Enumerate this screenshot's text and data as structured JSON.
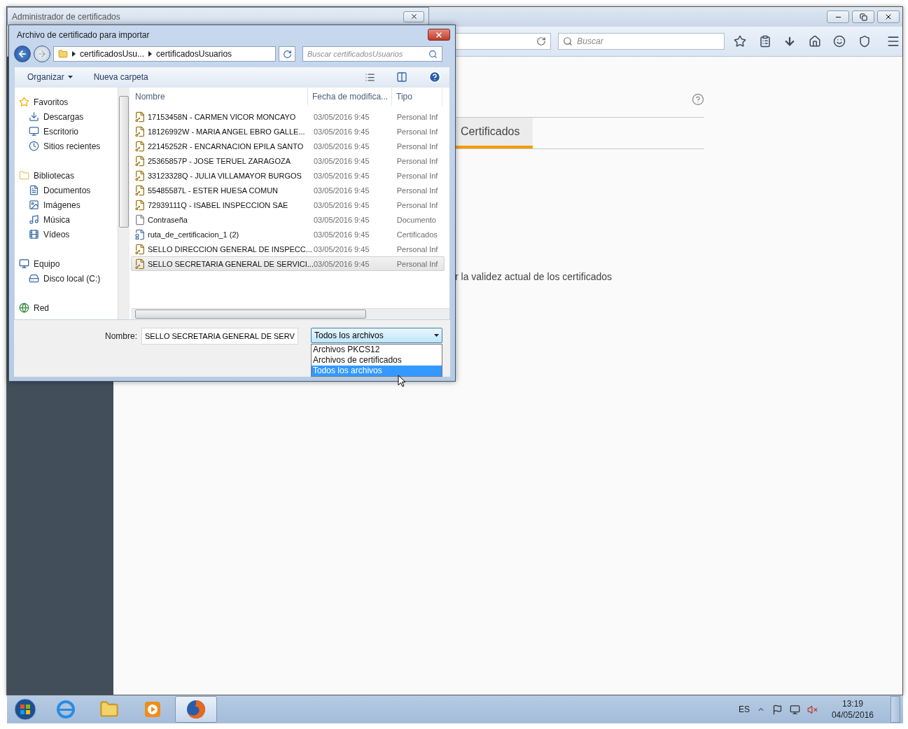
{
  "browser": {
    "search_placeholder": "Buscar",
    "tab": {
      "label": "Certificados",
      "selected": true
    },
    "text": "r la validez actual de los certificados"
  },
  "admin_window": {
    "title": "Administrador de certificados"
  },
  "file_dialog": {
    "title": "Archivo de certificado para importar",
    "breadcrumb": [
      "certificadosUsu...",
      "certificadosUsuarios"
    ],
    "search_placeholder": "Buscar certificadosUsuarios",
    "toolbar": [
      "Organizar",
      "Nueva carpeta"
    ],
    "nav": [
      {
        "label": "Favoritos",
        "children": [
          {
            "label": "Descargas"
          },
          {
            "label": "Escritorio"
          },
          {
            "label": "Sitios recientes"
          }
        ]
      },
      {
        "label": "Bibliotecas",
        "children": [
          {
            "label": "Documentos"
          },
          {
            "label": "Imágenes"
          },
          {
            "label": "Música"
          },
          {
            "label": "Vídeos"
          }
        ]
      },
      {
        "label": "Equipo",
        "children": [
          {
            "label": "Disco local (C:)"
          }
        ]
      },
      {
        "label": "Red"
      }
    ],
    "columns": [
      "Nombre",
      "Fecha de modifica...",
      "Tipo"
    ],
    "files": [
      {
        "name": "17153458N - CARMEN VICOR MONCAYO",
        "date": "03/05/2016 9:45",
        "type": "Personal Inf",
        "kind": "pfx",
        "selected": false
      },
      {
        "name": "18126992W - MARIA ANGEL EBRO GALLE...",
        "date": "03/05/2016 9:45",
        "type": "Personal Inf",
        "kind": "pfx",
        "selected": false
      },
      {
        "name": "22145252R - ENCARNACION EPILA SANTO",
        "date": "03/05/2016 9:45",
        "type": "Personal Inf",
        "kind": "pfx",
        "selected": false
      },
      {
        "name": "25365857P - JOSE TERUEL ZARAGOZA",
        "date": "03/05/2016 9:45",
        "type": "Personal Inf",
        "kind": "pfx",
        "selected": false
      },
      {
        "name": "33123328Q - JULIA VILLAMAYOR BURGOS",
        "date": "03/05/2016 9:45",
        "type": "Personal Inf",
        "kind": "pfx",
        "selected": false
      },
      {
        "name": "55485587L - ESTER HUESA COMUN",
        "date": "03/05/2016 9:45",
        "type": "Personal Inf",
        "kind": "pfx",
        "selected": false
      },
      {
        "name": "72939111Q - ISABEL INSPECCION SAE",
        "date": "03/05/2016 9:45",
        "type": "Personal Inf",
        "kind": "pfx",
        "selected": false
      },
      {
        "name": "Contraseña",
        "date": "03/05/2016 9:45",
        "type": "Documento",
        "kind": "doc",
        "selected": false
      },
      {
        "name": "ruta_de_certificacion_1 (2)",
        "date": "03/05/2016 9:45",
        "type": "Certificados",
        "kind": "cert",
        "selected": false
      },
      {
        "name": "SELLO DIRECCION GENERAL DE INSPECC...",
        "date": "03/05/2016 9:45",
        "type": "Personal Inf",
        "kind": "pfx",
        "selected": false
      },
      {
        "name": "SELLO SECRETARIA GENERAL DE SERVICI...",
        "date": "03/05/2016 9:45",
        "type": "Personal Inf",
        "kind": "pfx",
        "selected": true
      }
    ],
    "filename_label": "Nombre:",
    "filename_value": "SELLO SECRETARIA GENERAL DE SERV",
    "filetype": {
      "value": "Todos los archivos",
      "options": [
        {
          "label": "Archivos PKCS12",
          "selected": false
        },
        {
          "label": "Archivos de certificados",
          "selected": false
        },
        {
          "label": "Todos los archivos",
          "selected": true
        }
      ]
    }
  },
  "taskbar": {
    "language": "ES",
    "time": "13:19",
    "date": "04/05/2016"
  }
}
